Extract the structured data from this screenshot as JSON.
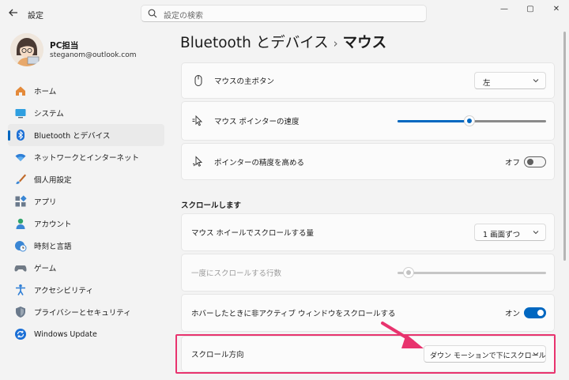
{
  "window": {
    "app_title": "設定",
    "minimize": "—",
    "maximize": "▢",
    "close": "✕"
  },
  "search": {
    "placeholder": "設定の検索"
  },
  "profile": {
    "name": "PC担当",
    "email": "steganom@outlook.com"
  },
  "sidebar": {
    "items": [
      {
        "label": "ホーム",
        "icon": "home-icon"
      },
      {
        "label": "システム",
        "icon": "monitor-icon"
      },
      {
        "label": "Bluetooth とデバイス",
        "icon": "bluetooth-icon",
        "active": true
      },
      {
        "label": "ネットワークとインターネット",
        "icon": "wifi-icon"
      },
      {
        "label": "個人用設定",
        "icon": "brush-icon"
      },
      {
        "label": "アプリ",
        "icon": "apps-icon"
      },
      {
        "label": "アカウント",
        "icon": "person-icon"
      },
      {
        "label": "時刻と言語",
        "icon": "globe-clock-icon"
      },
      {
        "label": "ゲーム",
        "icon": "gamepad-icon"
      },
      {
        "label": "アクセシビリティ",
        "icon": "accessibility-icon"
      },
      {
        "label": "プライバシーとセキュリティ",
        "icon": "shield-icon"
      },
      {
        "label": "Windows Update",
        "icon": "update-icon"
      }
    ]
  },
  "breadcrumb": {
    "parent": "Bluetooth とデバイス",
    "separator": "›",
    "current": "マウス"
  },
  "settings": {
    "primary_button": {
      "label": "マウスの主ボタン",
      "value": "左"
    },
    "pointer_speed": {
      "label": "マウス ポインターの速度",
      "level": 0.48
    },
    "enhance_precision": {
      "label": "ポインターの精度を高める",
      "state_text": "オフ",
      "on": false
    }
  },
  "scroll_section": {
    "heading": "スクロールします",
    "wheel_amount": {
      "label": "マウス ホイールでスクロールする量",
      "value": "1 画面ずつ"
    },
    "lines_at_once": {
      "label": "一度にスクロールする行数",
      "level": 0.04,
      "disabled": true
    },
    "inactive_scroll": {
      "label": "ホバーしたときに非アクティブ ウィンドウをスクロールする",
      "state_text": "オン",
      "on": true
    },
    "scroll_direction": {
      "label": "スクロール方向",
      "value": "ダウン モーションで下にスクロール"
    }
  },
  "colors": {
    "accent": "#0067c0",
    "highlight": "#e8336e",
    "background": "#f3f3f3"
  }
}
